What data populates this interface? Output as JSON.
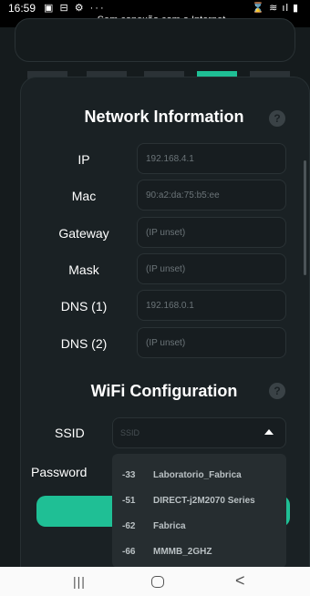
{
  "status_bar": {
    "time": "16:59",
    "left_icons": "▣ ⊟ ⚙ ···",
    "right_icons": "⌛ ≋ ıl ▮",
    "connection_message": "Sem conexão com a Internet"
  },
  "network": {
    "title": "Network Information",
    "help": "?",
    "rows": [
      {
        "label": "IP",
        "value": "192.168.4.1"
      },
      {
        "label": "Mac",
        "value": "90:a2:da:75:b5:ee"
      },
      {
        "label": "Gateway",
        "value": "(IP unset)"
      },
      {
        "label": "Mask",
        "value": "(IP unset)"
      },
      {
        "label": "DNS (1)",
        "value": "192.168.0.1"
      },
      {
        "label": "DNS (2)",
        "value": "(IP unset)"
      }
    ]
  },
  "wifi": {
    "title": "WiFi Configuration",
    "help": "?",
    "ssid_label": "SSID",
    "ssid_placeholder": "SSID",
    "password_label": "Password",
    "networks": [
      {
        "rssi": "-33",
        "name": "Laboratorio_Fabrica"
      },
      {
        "rssi": "-51",
        "name": "DIRECT-j2M2070 Series"
      },
      {
        "rssi": "-62",
        "name": "Fabrica"
      },
      {
        "rssi": "-66",
        "name": "MMMB_2GHZ"
      }
    ]
  },
  "nav": {
    "recents": "|||",
    "back": "<"
  },
  "colors": {
    "accent": "#1fbf95",
    "background": "#151b1d",
    "card": "#1a2124"
  }
}
